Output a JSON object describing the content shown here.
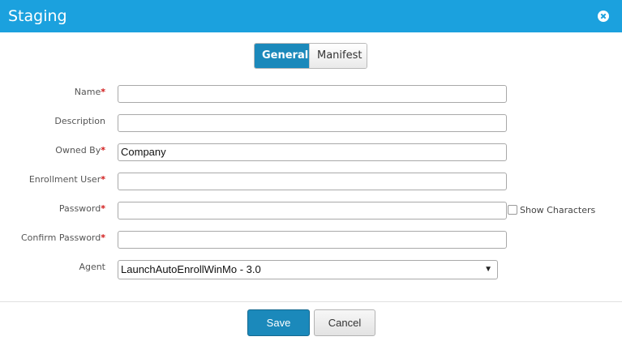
{
  "dialog": {
    "title": "Staging",
    "close_icon": "close-circle-icon",
    "accent_color": "#1ba1de"
  },
  "tabs": [
    {
      "label": "General",
      "active": true
    },
    {
      "label": "Manifest",
      "active": false
    }
  ],
  "form": {
    "name": {
      "label": "Name",
      "required": "*",
      "value": ""
    },
    "description": {
      "label": "Description",
      "value": ""
    },
    "owned_by": {
      "label": "Owned By",
      "required": "*",
      "value": "Company"
    },
    "enrollment_user": {
      "label": "Enrollment User",
      "required": "*",
      "value": ""
    },
    "password": {
      "label": "Password",
      "required": "*",
      "value": ""
    },
    "show_characters": {
      "label": "Show Characters",
      "checked": false
    },
    "confirm_password": {
      "label": "Confirm Password",
      "required": "*",
      "value": ""
    },
    "agent": {
      "label": "Agent",
      "selected": "LaunchAutoEnrollWinMo - 3.0",
      "arrow": "▼"
    }
  },
  "footer": {
    "save_label": "Save",
    "cancel_label": "Cancel"
  }
}
